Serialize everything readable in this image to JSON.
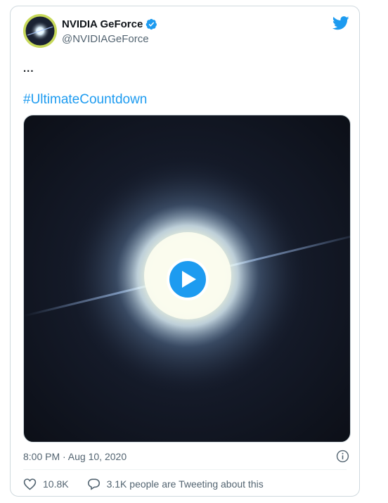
{
  "tweet": {
    "author": {
      "display_name": "NVIDIA GeForce",
      "handle": "@NVIDIAGeForce",
      "verified": true,
      "avatar_icon": "nvidia-geforce-avatar",
      "avatar_bg": "#c7d95a"
    },
    "text": "...",
    "hashtag": "#UltimateCountdown",
    "media": {
      "kind": "video",
      "play_icon": "play-icon"
    },
    "timestamp": "8:00 PM · Aug 10, 2020",
    "likes": "10.8K",
    "tweeting_text": "3.1K people are Tweeting about this"
  },
  "icons": {
    "brand": "twitter-bird-icon",
    "info": "info-icon",
    "like": "heart-icon",
    "reply": "speech-bubble-icon",
    "verified": "verified-badge-icon"
  },
  "colors": {
    "accent": "#1d9bf0",
    "text": "#0f1419",
    "muted": "#536471",
    "border": "#cfd9de"
  }
}
